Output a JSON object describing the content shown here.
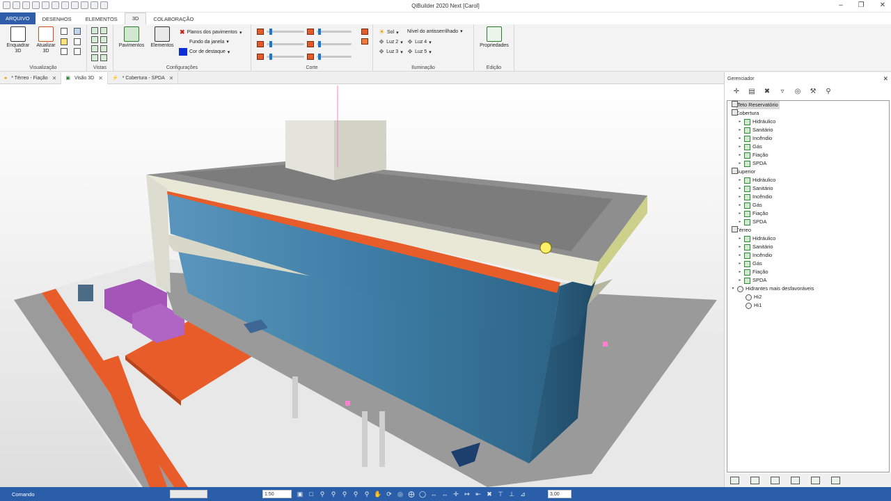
{
  "window": {
    "title": "QiBuilder 2020 Next [Carol]"
  },
  "menu_tabs": [
    {
      "label": "ARQUIVO"
    },
    {
      "label": "DESENHOS"
    },
    {
      "label": "ELEMENTOS"
    },
    {
      "label": "3D"
    },
    {
      "label": "COLABORAÇÃO"
    }
  ],
  "ribbon": {
    "visualizacao": {
      "label": "Visualização",
      "enquadrar": "Enquadrar 3D",
      "atualizar": "Atualizar 3D"
    },
    "vistas": {
      "label": "Vistas"
    },
    "configuracoes": {
      "label": "Configurações",
      "pavimentos": "Pavimentos",
      "elementos": "Elementos",
      "planos": "Planos dos pavimentos",
      "fundo": "Fundo da janela",
      "cor_destaque": "Cor de destaque",
      "cor_destaque_color": "#0b2fd6"
    },
    "corte": {
      "label": "Corte"
    },
    "iluminacao": {
      "label": "Iluminação",
      "sol": "Sol",
      "antisserrilhado": "Nível do antisserrilhado",
      "luz2": "Luz 2",
      "luz3": "Luz 3",
      "luz4": "Luz 4",
      "luz5": "Luz 5"
    },
    "edicao": {
      "label": "Edição",
      "propriedades": "Propriedades"
    }
  },
  "doc_tabs": [
    {
      "label": "* Térreo - Fiação"
    },
    {
      "label": "Visão 3D"
    },
    {
      "label": "* Cobertura - SPDA"
    }
  ],
  "manager": {
    "title": "Gerenciador",
    "tree": [
      {
        "label": "Teto Reservatório",
        "level": 0,
        "expanded": false,
        "selected": true
      },
      {
        "label": "Cobertura",
        "level": 0,
        "expanded": true
      },
      {
        "label": "Hidráulico",
        "level": 1
      },
      {
        "label": "Sanitário",
        "level": 1
      },
      {
        "label": "Incêndio",
        "level": 1
      },
      {
        "label": "Gás",
        "level": 1
      },
      {
        "label": "Fiação",
        "level": 1
      },
      {
        "label": "SPDA",
        "level": 1
      },
      {
        "label": "Superior",
        "level": 0,
        "expanded": true
      },
      {
        "label": "Hidráulico",
        "level": 1
      },
      {
        "label": "Sanitário",
        "level": 1
      },
      {
        "label": "Incêndio",
        "level": 1
      },
      {
        "label": "Gás",
        "level": 1
      },
      {
        "label": "Fiação",
        "level": 1
      },
      {
        "label": "SPDA",
        "level": 1
      },
      {
        "label": "Térreo",
        "level": 0,
        "expanded": true
      },
      {
        "label": "Hidráulico",
        "level": 1
      },
      {
        "label": "Sanitário",
        "level": 1
      },
      {
        "label": "Incêndio",
        "level": 1
      },
      {
        "label": "Gás",
        "level": 1
      },
      {
        "label": "Fiação",
        "level": 1
      },
      {
        "label": "SPDA",
        "level": 1
      },
      {
        "label": "Hidrantes mais desfavoráveis",
        "level": 0,
        "expanded": true
      },
      {
        "label": "Hi2",
        "level": 2
      },
      {
        "label": "Hi1",
        "level": 2
      }
    ]
  },
  "status": {
    "command_label": "Comando",
    "scale": "1:50",
    "zoom": "3,00"
  },
  "colors": {
    "accent_orange": "#e85c2a",
    "glass_blue": "#3e7ea6",
    "status_blue": "#2b5ea9",
    "purple_block": "#a455b8"
  }
}
